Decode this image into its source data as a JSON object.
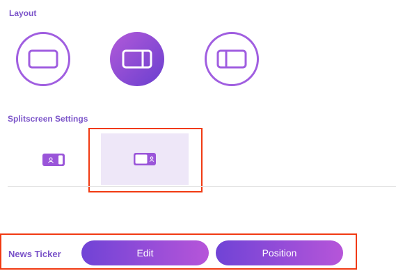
{
  "layout": {
    "label": "Layout",
    "options": [
      {
        "name": "fullscreen",
        "selected": false
      },
      {
        "name": "split-right",
        "selected": true
      },
      {
        "name": "split-left",
        "selected": false
      }
    ]
  },
  "splitscreen": {
    "label": "Splitscreen Settings",
    "options": [
      {
        "name": "overlay-left",
        "selected": false
      },
      {
        "name": "overlay-right",
        "selected": true
      }
    ]
  },
  "news_ticker": {
    "label": "News Ticker",
    "edit_label": "Edit",
    "position_label": "Position"
  },
  "colors": {
    "accent": "#7b54c9",
    "gradient_start": "#7043d6",
    "gradient_end": "#b655d9",
    "highlight": "#f13a12",
    "selected_bg": "#eee7f8"
  }
}
